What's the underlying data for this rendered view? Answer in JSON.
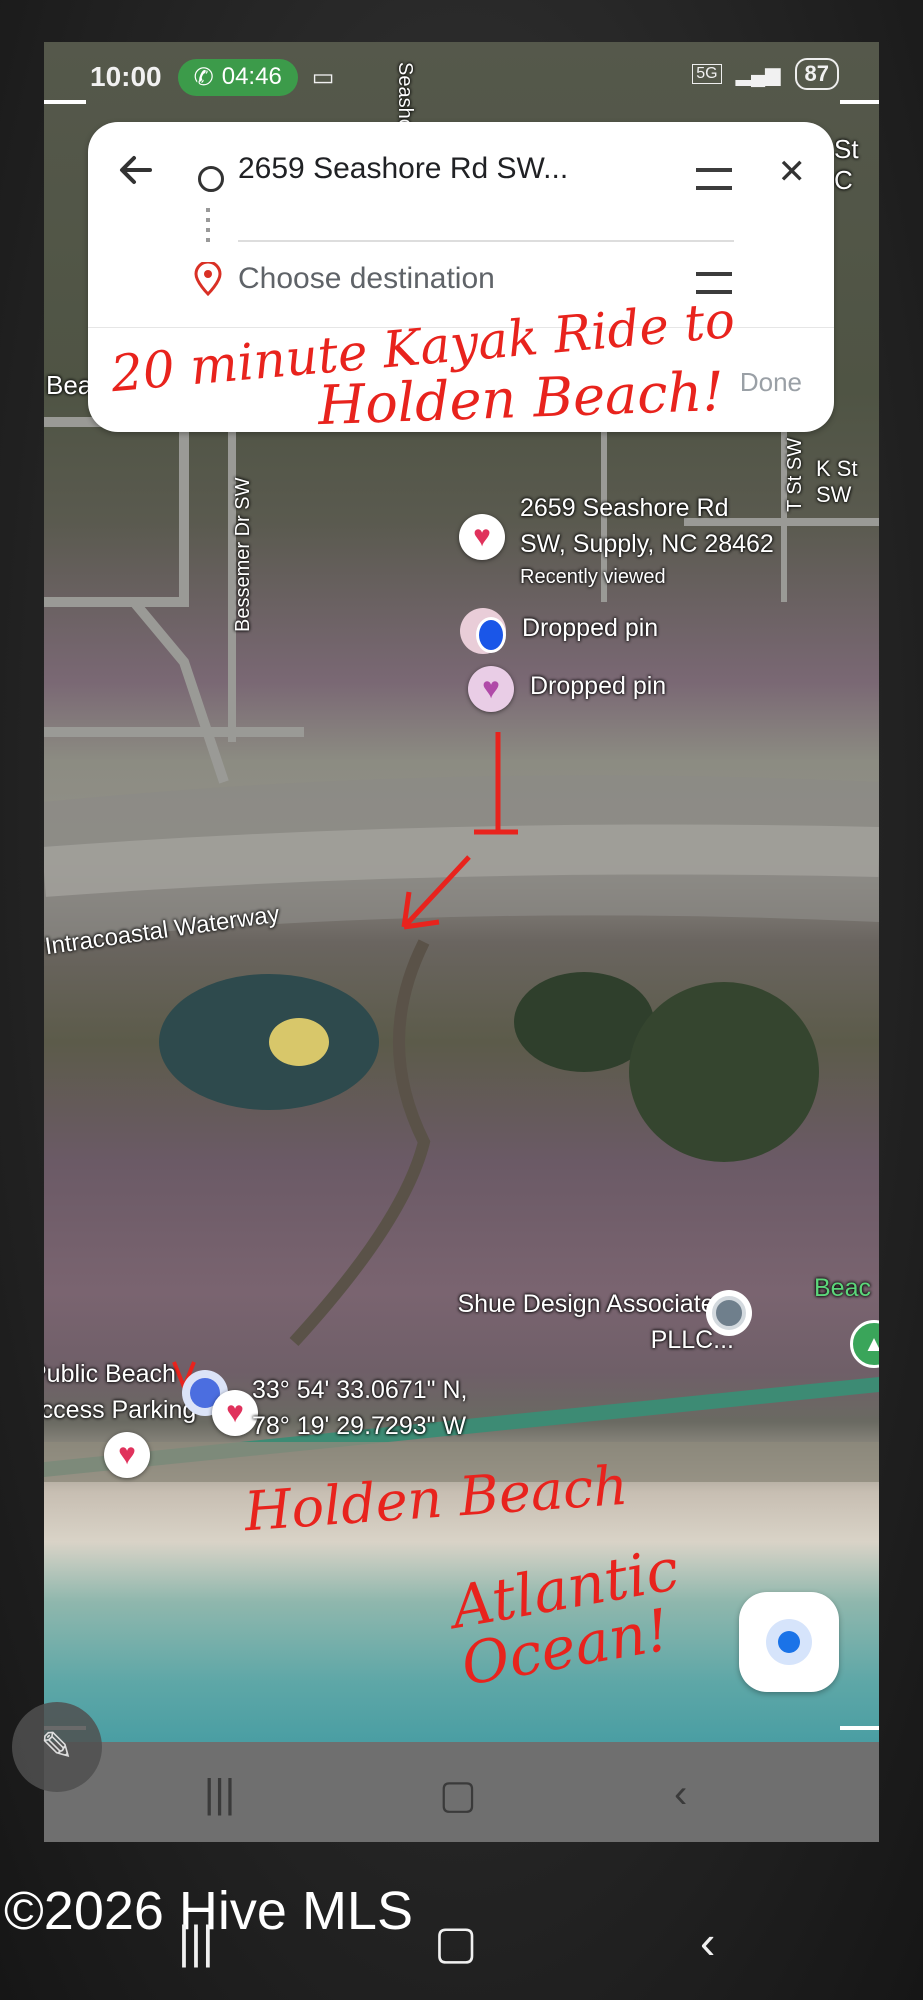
{
  "status_bar": {
    "time": "10:00",
    "call_timer": "04:46",
    "battery": "87",
    "network": "5G"
  },
  "directions": {
    "origin_text": "2659 Seashore Rd SW...",
    "destination_placeholder": "Choose destination",
    "done_label": "Done"
  },
  "annotations": {
    "headline_line1": "20 minute Kayak Ride to",
    "headline_line2": "Holden Beach!",
    "holden_beach": "Holden Beach",
    "atlantic_ocean": "Atlantic Ocean!"
  },
  "map_labels": {
    "address_line1": "2659 Seashore Rd",
    "address_line2": "SW, Supply, NC 28462",
    "recently_viewed": "Recently viewed",
    "dropped_pin_1": "Dropped pin",
    "dropped_pin_2": "Dropped pin",
    "waterway": "Intracoastal Waterway",
    "street_bessemer": "Bessemer Dr SW",
    "street_k": "K St SW",
    "street_t": "T St SW",
    "street_seashore": "Seashore St",
    "business": "Shue Design Associates, PLLC...",
    "public_beach_line1": "Public Beach",
    "public_beach_line2": "Access Parking",
    "coords_line1": "33° 54' 33.0671\" N,",
    "coords_line2": "78° 19' 29.7293\" W",
    "beach_edge": "Beac",
    "bea_edge": "Bea",
    "stc_edge": "St C"
  },
  "watermark": "©2026 Hive MLS",
  "colors": {
    "annotation_red": "#e8231d",
    "heart_pink": "#e0325c",
    "accent_blue": "#1a73e8"
  }
}
